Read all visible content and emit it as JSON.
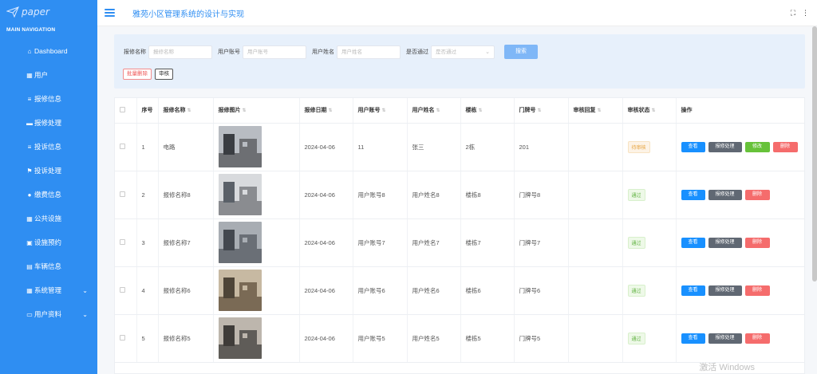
{
  "brand": {
    "name": "paper"
  },
  "nav": {
    "title": "MAIN NAVIGATION",
    "items": [
      {
        "label": "Dashboard",
        "icon": "home-icon"
      },
      {
        "label": "用户",
        "icon": "grid-icon"
      },
      {
        "label": "报修信息",
        "icon": "list-icon"
      },
      {
        "label": "报修处理",
        "icon": "monitor-icon"
      },
      {
        "label": "投诉信息",
        "icon": "list-icon"
      },
      {
        "label": "投诉处理",
        "icon": "flag-icon"
      },
      {
        "label": "缴费信息",
        "icon": "user-icon"
      },
      {
        "label": "公共设施",
        "icon": "grid-icon"
      },
      {
        "label": "设施预约",
        "icon": "book-icon"
      },
      {
        "label": "车辆信息",
        "icon": "clipboard-icon"
      },
      {
        "label": "系统管理",
        "icon": "grid-icon"
      },
      {
        "label": "用户资料",
        "icon": "card-icon"
      }
    ]
  },
  "header": {
    "title": "雅苑小区管理系统的设计与实现"
  },
  "filters": {
    "f1_label": "报修名称",
    "f1_placeholder": "报修名称",
    "f2_label": "用户账号",
    "f2_placeholder": "用户账号",
    "f3_label": "用户姓名",
    "f3_placeholder": "用户姓名",
    "f4_label": "是否通过",
    "f4_placeholder": "是否通过",
    "search_label": "搜索",
    "batch_delete_label": "批量删除",
    "audit_label": "审核"
  },
  "table": {
    "columns": [
      "序号",
      "报修名称",
      "报修图片",
      "报修日期",
      "用户账号",
      "用户姓名",
      "楼栋",
      "门牌号",
      "审核回复",
      "审核状态",
      "操作"
    ],
    "rows": [
      {
        "idx": "1",
        "name": "电路",
        "date": "2024-04-06",
        "account": "11",
        "username": "张三",
        "building": "2栋",
        "door": "201",
        "reply": "",
        "status": "待审核"
      },
      {
        "idx": "2",
        "name": "报修名称8",
        "date": "2024-04-06",
        "account": "用户账号8",
        "username": "用户姓名8",
        "building": "楼栋8",
        "door": "门牌号8",
        "reply": "",
        "status": "通过"
      },
      {
        "idx": "3",
        "name": "报修名称7",
        "date": "2024-04-06",
        "account": "用户账号7",
        "username": "用户姓名7",
        "building": "楼栋7",
        "door": "门牌号7",
        "reply": "",
        "status": "通过"
      },
      {
        "idx": "4",
        "name": "报修名称6",
        "date": "2024-04-06",
        "account": "用户账号6",
        "username": "用户姓名6",
        "building": "楼栋6",
        "door": "门牌号6",
        "reply": "",
        "status": "通过"
      },
      {
        "idx": "5",
        "name": "报修名称5",
        "date": "2024-04-06",
        "account": "用户账号5",
        "username": "用户姓名5",
        "building": "楼栋5",
        "door": "门牌号5",
        "reply": "",
        "status": "通过"
      }
    ],
    "actions": {
      "view": "查看",
      "process": "报修处理",
      "edit": "修改",
      "delete": "删除"
    }
  },
  "watermark": "激活 Windows",
  "colors": {
    "sidebar": "#2f8ef2",
    "accent": "#2f8ef2",
    "pending": "#e6a23c",
    "passed": "#5cb03c"
  }
}
